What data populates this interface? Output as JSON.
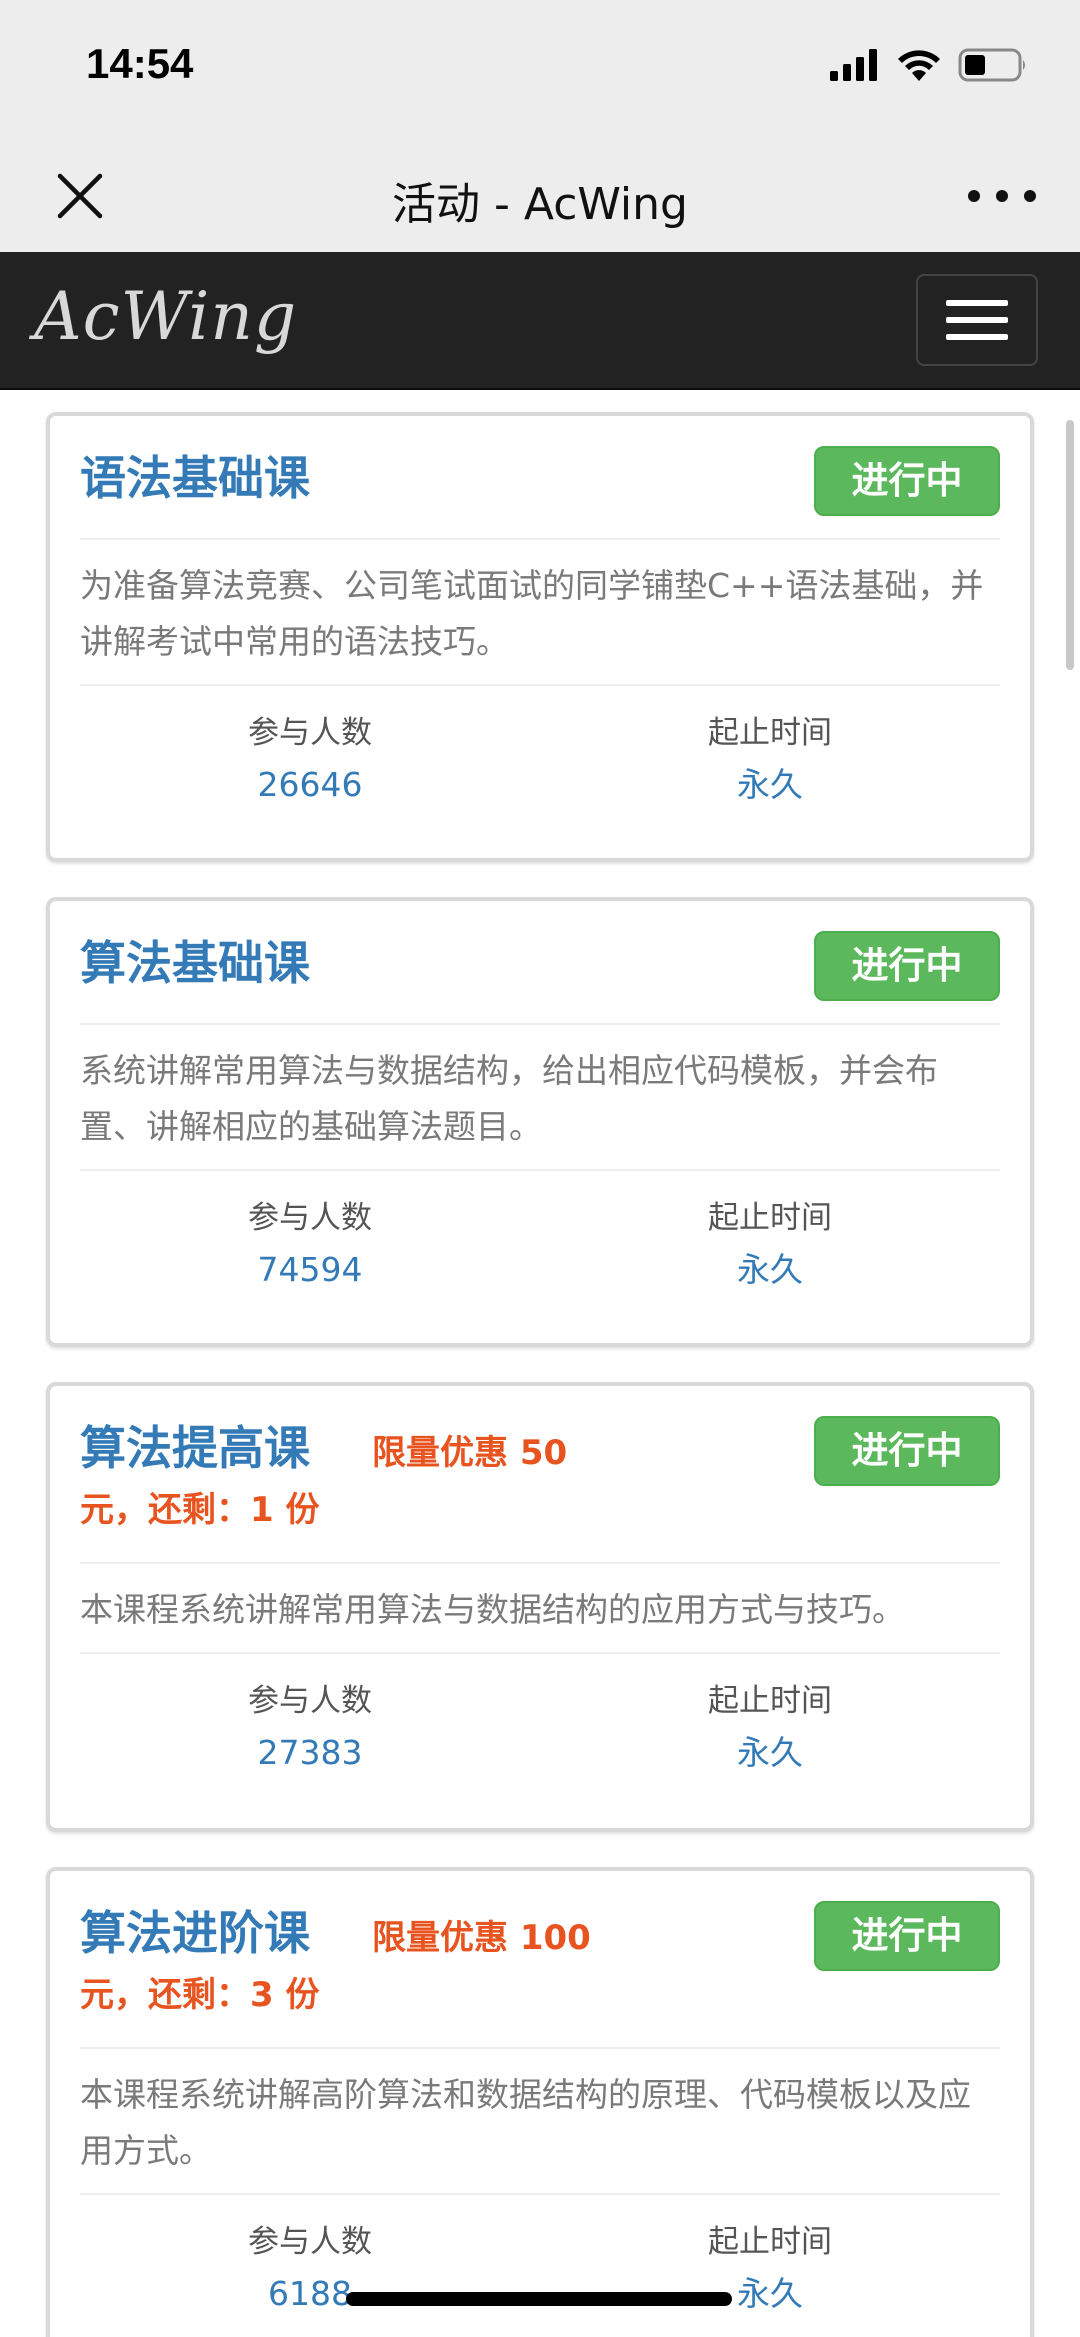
{
  "status_bar": {
    "time": "14:54"
  },
  "window": {
    "title": "活动 - AcWing"
  },
  "navbar": {
    "brand": "AcWing"
  },
  "courses": [
    {
      "title": "语法基础课",
      "promo_line1": "",
      "promo_line2": "",
      "status": "进行中",
      "description": "为准备算法竞赛、公司笔试面试的同学铺垫C++语法基础，并讲解考试中常用的语法技巧。",
      "participants_label": "参与人数",
      "participants": "26646",
      "duration_label": "起止时间",
      "duration": "永久"
    },
    {
      "title": "算法基础课",
      "promo_line1": "",
      "promo_line2": "",
      "status": "进行中",
      "description": "系统讲解常用算法与数据结构，给出相应代码模板，并会布置、讲解相应的基础算法题目。",
      "participants_label": "参与人数",
      "participants": "74594",
      "duration_label": "起止时间",
      "duration": "永久"
    },
    {
      "title": "算法提高课",
      "promo_line1": "限量优惠 50",
      "promo_line2": "元，还剩：1 份",
      "status": "进行中",
      "description": "本课程系统讲解常用算法与数据结构的应用方式与技巧。",
      "participants_label": "参与人数",
      "participants": "27383",
      "duration_label": "起止时间",
      "duration": "永久"
    },
    {
      "title": "算法进阶课",
      "promo_line1": "限量优惠 100",
      "promo_line2": "元，还剩：3 份",
      "status": "进行中",
      "description": "本课程系统讲解高阶算法和数据结构的原理、代码模板以及应用方式。",
      "participants_label": "参与人数",
      "participants": "6188",
      "duration_label": "起止时间",
      "duration": "永久"
    }
  ],
  "colors": {
    "title_blue": "#337ab7",
    "promo_orange": "#e8541f",
    "badge_green": "#5cb85c",
    "navbar_bg": "#222222",
    "chrome_bg": "#ededed"
  }
}
